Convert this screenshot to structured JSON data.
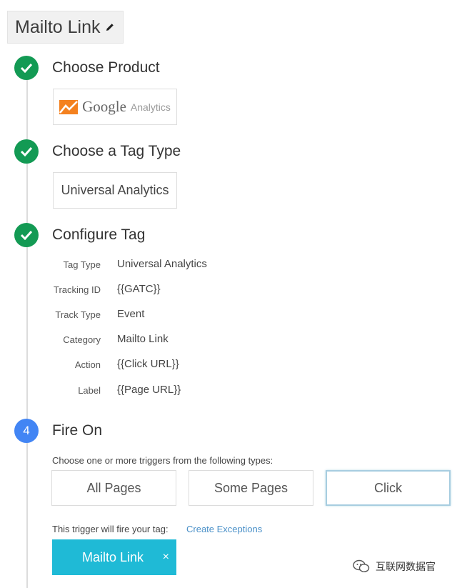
{
  "header": {
    "title": "Mailto Link",
    "edit_icon": "pencil-icon"
  },
  "steps": [
    {
      "title": "Choose Product",
      "status": "done",
      "icon": "check-icon"
    },
    {
      "title": "Choose a Tag Type",
      "status": "done",
      "icon": "check-icon"
    },
    {
      "title": "Configure Tag",
      "status": "done",
      "icon": "check-icon"
    },
    {
      "title": "Fire On",
      "status": "active",
      "number": "4"
    }
  ],
  "product": {
    "brand": "Google",
    "sub": "Analytics",
    "logo_icon": "google-analytics-logo-icon"
  },
  "tag_type": {
    "label": "Universal Analytics"
  },
  "config": [
    {
      "label": "Tag Type",
      "value": "Universal Analytics"
    },
    {
      "label": "Tracking ID",
      "value": "{{GATC}}"
    },
    {
      "label": "Track Type",
      "value": "Event"
    },
    {
      "label": "Category",
      "value": "Mailto Link"
    },
    {
      "label": "Action",
      "value": "{{Click URL}}"
    },
    {
      "label": "Label",
      "value": "{{Page URL}}"
    }
  ],
  "fire_on": {
    "hint": "Choose one or more triggers from the following types:",
    "triggers": [
      {
        "label": "All Pages",
        "selected": false
      },
      {
        "label": "Some Pages",
        "selected": false
      },
      {
        "label": "Click",
        "selected": true
      }
    ],
    "fire_text": "This trigger will fire your tag:",
    "exceptions_link": "Create Exceptions",
    "chip": {
      "label": "Mailto Link",
      "close": "×"
    }
  },
  "watermark": {
    "text": "互联网数据官",
    "icon": "wechat-icon"
  },
  "colors": {
    "done": "#139a54",
    "active": "#4285f4",
    "chip": "#1fbad6",
    "link": "#4a90c8"
  }
}
